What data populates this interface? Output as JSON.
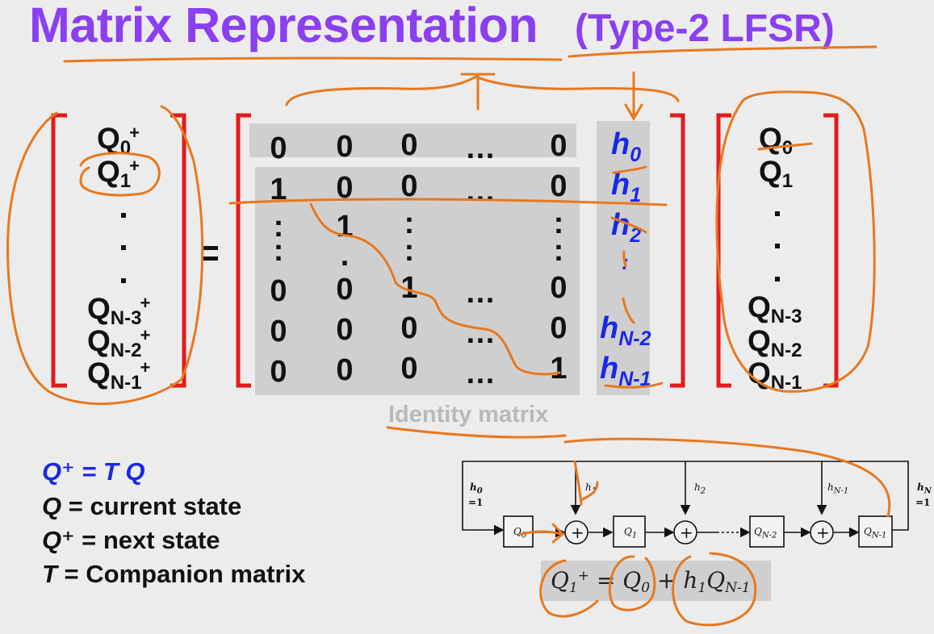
{
  "slide": {
    "title": "Matrix Representation",
    "subtitle": "(Type-2 LFSR)",
    "equals_sign": "=",
    "identity_label": "Identity matrix"
  },
  "next_state_vector": [
    "Q0+",
    "Q1+",
    "QN-3+",
    "QN-2+",
    "QN-1+"
  ],
  "companion_matrix": {
    "rows": [
      [
        "0",
        "0",
        "0",
        "…",
        "0"
      ],
      [
        "1",
        "0",
        "0",
        "…",
        "0"
      ],
      [
        ":",
        "1",
        ":",
        "",
        ":"
      ],
      [
        "0",
        "0",
        "1",
        "…",
        "0"
      ],
      [
        "0",
        "0",
        "0",
        "…",
        "0"
      ],
      [
        "0",
        "0",
        "0",
        "…",
        "1"
      ]
    ],
    "h_column": [
      "h0",
      "h1",
      "h2",
      "hN-2",
      "hN-1"
    ]
  },
  "state_vector": [
    "Q0",
    "Q1",
    "QN-3",
    "QN-2",
    "QN-1"
  ],
  "legend": {
    "line1": "Q⁺ = T Q",
    "line2_var": "Q",
    "line2_text": " = current state",
    "line3_var": "Q⁺",
    "line3_text": " = next state",
    "line4_var": "T",
    "line4_text": " = Companion matrix"
  },
  "circuit": {
    "h0_label": "h0",
    "h0_value": "=1",
    "hN_label": "hN",
    "hN_value": "=1",
    "taps": [
      "h1",
      "h2",
      "hN-1"
    ],
    "registers": [
      "Q0",
      "Q1",
      "QN-2",
      "QN-1"
    ],
    "xor_symbol": "+"
  },
  "equation": "Q1+ = Q0 + h1QN-1",
  "colors": {
    "title": "#8a3ff0",
    "bracket": "#e41b1b",
    "h_column": "#1a28e8",
    "annotation": "#e8781e",
    "shade": "#cfcfcf",
    "background": "#ececec"
  }
}
